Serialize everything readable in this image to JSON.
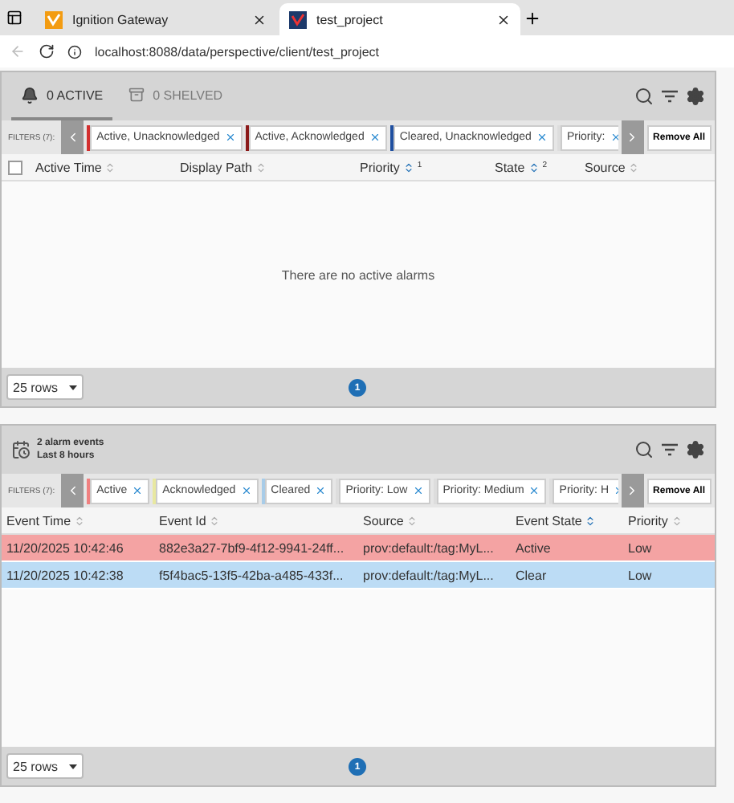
{
  "browser": {
    "tabs": [
      {
        "title": "Ignition Gateway",
        "selected": false,
        "kind": "gateway"
      },
      {
        "title": "test_project",
        "selected": true,
        "kind": "project"
      }
    ],
    "url": "localhost:8088/data/perspective/client/test_project"
  },
  "status_panel": {
    "tabs": [
      {
        "label": "0 ACTIVE",
        "selected": true,
        "kind": "bell"
      },
      {
        "label": "0 SHELVED",
        "selected": false,
        "kind": "shelf"
      }
    ],
    "filters_label": "FILTERS (7):",
    "filters": [
      {
        "label": "Active, Unacknowledged",
        "color": "#d32f2f"
      },
      {
        "label": "Active, Acknowledged",
        "color": "#8b1a1a"
      },
      {
        "label": "Cleared, Unacknowledged",
        "color": "#1f4fa0"
      },
      {
        "label": "Priority:",
        "color": "#dddddd"
      }
    ],
    "remove_all": "Remove All",
    "columns": [
      {
        "label": "Active Time",
        "sorted": false
      },
      {
        "label": "Display Path",
        "sorted": false
      },
      {
        "label": "Priority",
        "sorted": true,
        "order": "1"
      },
      {
        "label": "State",
        "sorted": true,
        "order": "2"
      },
      {
        "label": "Source",
        "sorted": false
      }
    ],
    "select_all_checked": false,
    "empty_message": "There are no active alarms",
    "rows_select": "25 rows",
    "page": "1"
  },
  "journal_panel": {
    "summary": "2 alarm events",
    "range": "Last 8 hours",
    "filters_label": "FILTERS (7):",
    "filters": [
      {
        "label": "Active",
        "color": "#f08080"
      },
      {
        "label": "Acknowledged",
        "color": "#e8e8a0"
      },
      {
        "label": "Cleared",
        "color": "#a8cce8"
      },
      {
        "label": "Priority: Low",
        "color": "#dddddd"
      },
      {
        "label": "Priority: Medium",
        "color": "#dddddd"
      },
      {
        "label": "Priority: H",
        "color": "#dddddd"
      }
    ],
    "remove_all": "Remove All",
    "columns": [
      {
        "label": "Event Time",
        "sorted": false
      },
      {
        "label": "Event Id",
        "sorted": false
      },
      {
        "label": "Source",
        "sorted": false
      },
      {
        "label": "Event State",
        "sorted": true
      },
      {
        "label": "Priority",
        "sorted": false
      }
    ],
    "rows": [
      {
        "cells": [
          "11/20/2025 10:42:46",
          "882e3a27-7bf9-4f12-9941-24ff...",
          "prov:default:/tag:MyL...",
          "Active",
          "Low"
        ],
        "color": "#f4a3a3"
      },
      {
        "cells": [
          "11/20/2025 10:42:38",
          "f5f4bac5-13f5-42ba-a485-433f...",
          "prov:default:/tag:MyL...",
          "Clear",
          "Low"
        ],
        "color": "#bcdcf5"
      }
    ],
    "rows_select": "25 rows",
    "page": "1"
  }
}
